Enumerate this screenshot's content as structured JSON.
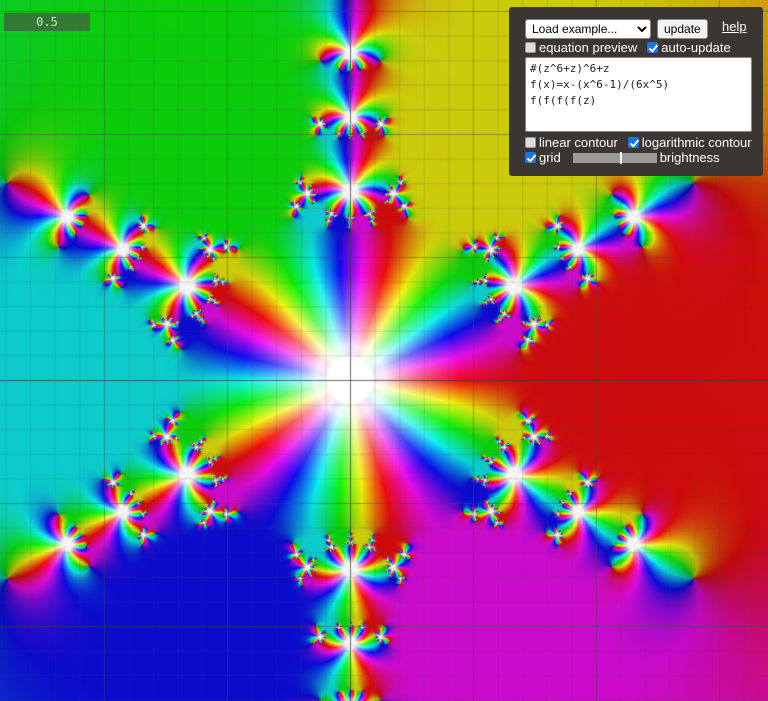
{
  "coord_readout": "0.5",
  "controls": {
    "examples_select": "Load example...",
    "update_label": "update",
    "help_label": "help",
    "equation_preview": {
      "label": "equation preview",
      "checked": false
    },
    "auto_update": {
      "label": "auto-update",
      "checked": true
    },
    "equation_text": "#(z^6+z)^6+z\nf(x)=x-(x^6-1)/(6x^5)\nf(f(f(f(z)",
    "linear_contour": {
      "label": "linear contour",
      "checked": false
    },
    "logarithmic_contour": {
      "label": "logarithmic contour",
      "checked": true
    },
    "grid": {
      "label": "grid",
      "checked": true
    },
    "brightness": {
      "label": "brightness",
      "value": 0.58
    }
  }
}
